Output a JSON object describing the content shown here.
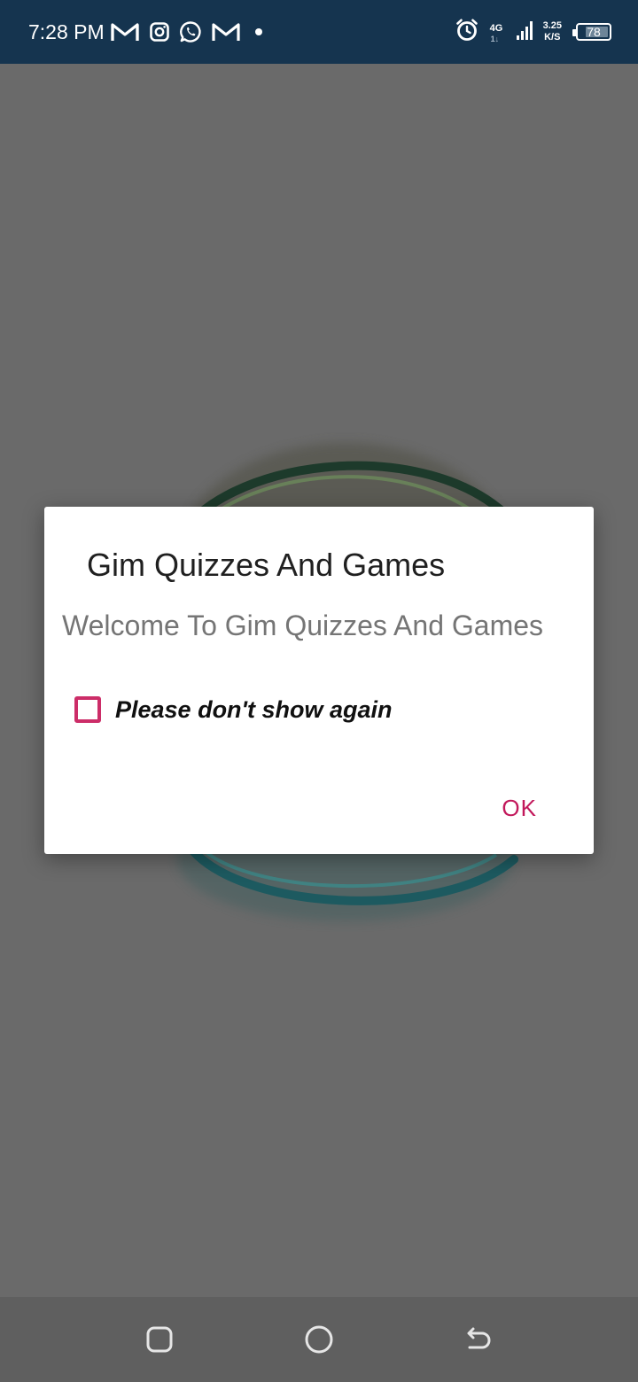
{
  "status_bar": {
    "time": "7:28 PM",
    "network_type": "4G",
    "network_sub": "1↓",
    "speed_value": "3.25",
    "speed_unit": "K/S",
    "battery_level": "78",
    "battery_fraction": 0.78,
    "left_icons": [
      "gmail-icon",
      "instagram-icon",
      "whatsapp-icon",
      "gmail-icon",
      "dot-icon"
    ],
    "right_icons": [
      "alarm-icon",
      "signal-icon",
      "battery-icon"
    ],
    "bar_color": "#15344f"
  },
  "dialog": {
    "title": "Gim Quizzes And Games",
    "message": "Welcome To Gim Quizzes And Games",
    "checkbox_label": "Please don't show again",
    "checkbox_checked": false,
    "ok_label": "OK",
    "accent_color": "#c2185b"
  },
  "nav_bar": {
    "buttons": [
      "recents-icon",
      "home-icon",
      "back-icon"
    ]
  }
}
